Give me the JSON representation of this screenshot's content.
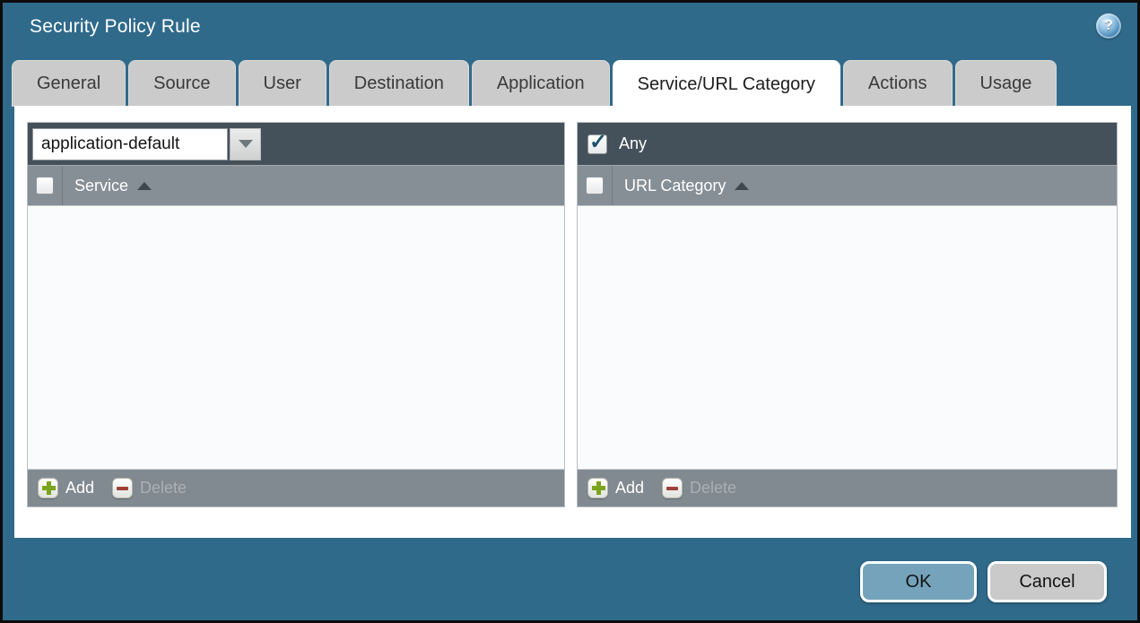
{
  "dialog": {
    "title": "Security Policy Rule"
  },
  "icons": {
    "help": "?",
    "check": "✓",
    "sort_asc": "triangle-up",
    "dropdown": "triangle-down",
    "add": "green-plus",
    "delete": "red-minus"
  },
  "tabs": {
    "active": "Service/URL Category",
    "items": [
      {
        "label": "General"
      },
      {
        "label": "Source"
      },
      {
        "label": "User"
      },
      {
        "label": "Destination"
      },
      {
        "label": "Application"
      },
      {
        "label": "Service/URL Category"
      },
      {
        "label": "Actions"
      },
      {
        "label": "Usage"
      }
    ]
  },
  "service_panel": {
    "service_type_dropdown": {
      "value": "application-default"
    },
    "header": {
      "column_label": "Service",
      "checkbox_checked": false
    },
    "rows": [],
    "footer": {
      "add_label": "Add",
      "delete_label": "Delete",
      "delete_enabled": false
    }
  },
  "url_category_panel": {
    "any_checkbox": {
      "label": "Any",
      "checked": true
    },
    "header": {
      "column_label": "URL Category",
      "checkbox_checked": false
    },
    "rows": [],
    "footer": {
      "add_label": "Add",
      "delete_label": "Delete",
      "delete_enabled": false
    }
  },
  "dialog_buttons": {
    "ok_label": "OK",
    "cancel_label": "Cancel"
  },
  "colors": {
    "background": "#306a8b",
    "panel_topbar": "#45515a",
    "panel_header": "#868f96",
    "panel_footer": "#818a91",
    "inactive_tab": "#cacbca",
    "active_tab": "#ffffff",
    "ok_button": "#74a3bb",
    "cancel_button": "#c9c9c9",
    "add_icon_green": "#7ba41c",
    "delete_icon_red": "#9e4136",
    "check_blue": "#1b516f"
  }
}
